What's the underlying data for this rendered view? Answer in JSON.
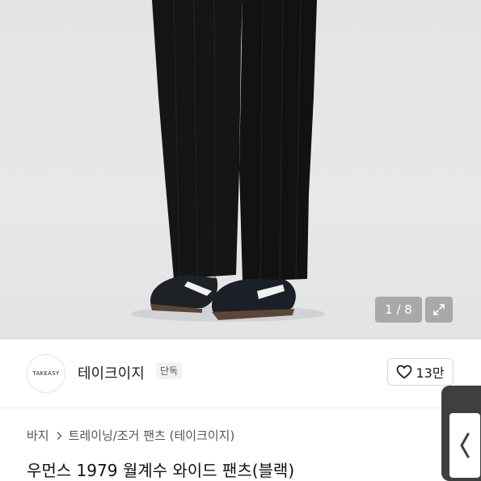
{
  "gallery": {
    "pager_text": "1 / 8",
    "expand_icon": "expand-arrows-icon"
  },
  "brand": {
    "logo_text": "TAKEASY",
    "name": "테이크이지",
    "badge": "단독"
  },
  "like": {
    "icon": "heart-outline-icon",
    "count": "13만"
  },
  "breadcrumb": {
    "items": [
      "바지",
      "트레이닝/조거 팬츠 (테이크이지)"
    ],
    "separator_icon": "chevron-right-icon"
  },
  "product": {
    "title": "우먼스 1979 월계수 와이드 팬츠(블랙)"
  },
  "side_tab": {
    "icon": "chevron-left-icon"
  }
}
